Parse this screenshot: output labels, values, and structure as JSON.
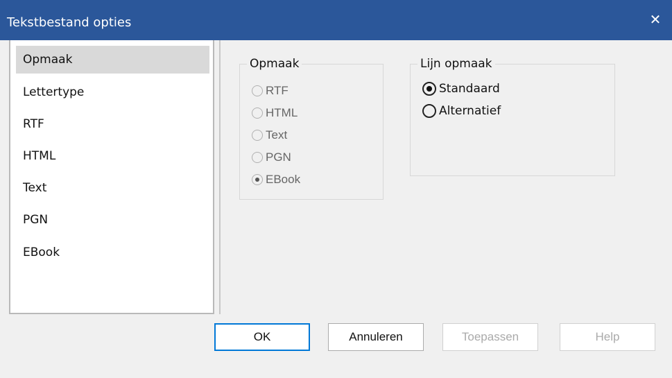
{
  "window": {
    "title": "Tekstbestand opties",
    "close_symbol": "✕"
  },
  "sidebar": {
    "items": [
      {
        "label": "Opmaak",
        "selected": true
      },
      {
        "label": "Lettertype",
        "selected": false
      },
      {
        "label": "RTF",
        "selected": false
      },
      {
        "label": "HTML",
        "selected": false
      },
      {
        "label": "Text",
        "selected": false
      },
      {
        "label": "PGN",
        "selected": false
      },
      {
        "label": "EBook",
        "selected": false
      }
    ]
  },
  "format_group": {
    "legend": "Opmaak",
    "options": [
      {
        "label": "RTF",
        "checked": false
      },
      {
        "label": "HTML",
        "checked": false
      },
      {
        "label": "Text",
        "checked": false
      },
      {
        "label": "PGN",
        "checked": false
      },
      {
        "label": "EBook",
        "checked": true
      }
    ]
  },
  "line_group": {
    "legend": "Lijn opmaak",
    "options": [
      {
        "label": "Standaard",
        "checked": true
      },
      {
        "label": "Alternatief",
        "checked": false
      }
    ]
  },
  "buttons": {
    "ok": "OK",
    "cancel": "Annuleren",
    "apply": "Toepassen",
    "help": "Help"
  },
  "colors": {
    "titlebar": "#2b579a",
    "accent": "#0078d7"
  }
}
